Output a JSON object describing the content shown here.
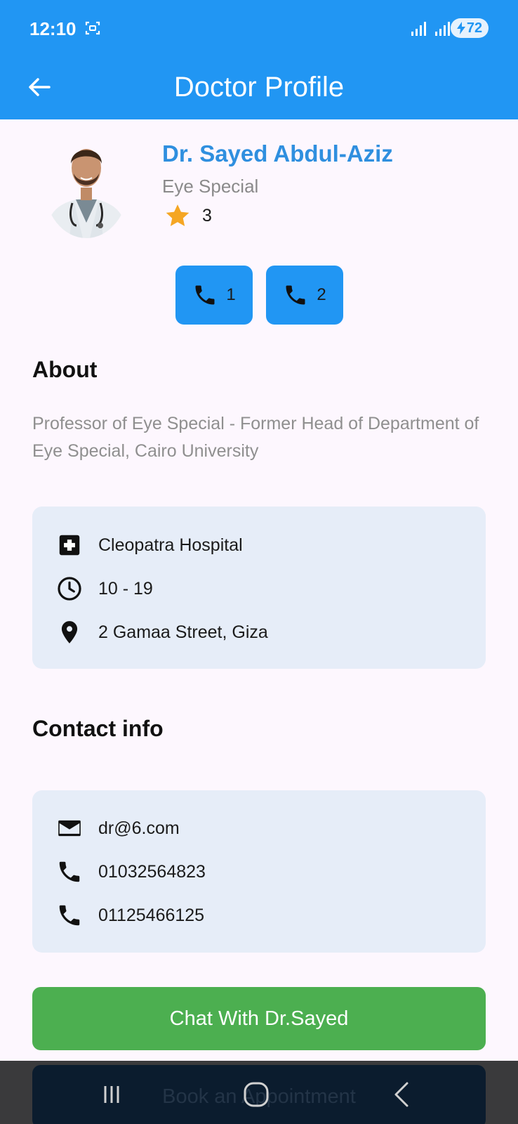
{
  "status_bar": {
    "time": "12:10",
    "battery": "72"
  },
  "app_bar": {
    "title": "Doctor Profile"
  },
  "doctor": {
    "name": "Dr. Sayed Abdul-Aziz",
    "specialty": "Eye Special",
    "rating": "3"
  },
  "call_buttons": [
    {
      "label": "1"
    },
    {
      "label": "2"
    }
  ],
  "about": {
    "title": "About",
    "text": "Professor of Eye Special - Former Head of Department of Eye Special, Cairo University"
  },
  "location": {
    "hospital": "Cleopatra Hospital",
    "hours": "10 - 19",
    "address": "2 Gamaa Street, Giza"
  },
  "contact": {
    "title": "Contact info",
    "email": "dr@6.com",
    "phone1": "01032564823",
    "phone2": "01125466125"
  },
  "actions": {
    "chat": "Chat With Dr.Sayed",
    "book": "Book an Appointment"
  },
  "colors": {
    "primary": "#2196f3",
    "green": "#4caf50",
    "card": "#e6edf8",
    "star": "#f5a623"
  }
}
